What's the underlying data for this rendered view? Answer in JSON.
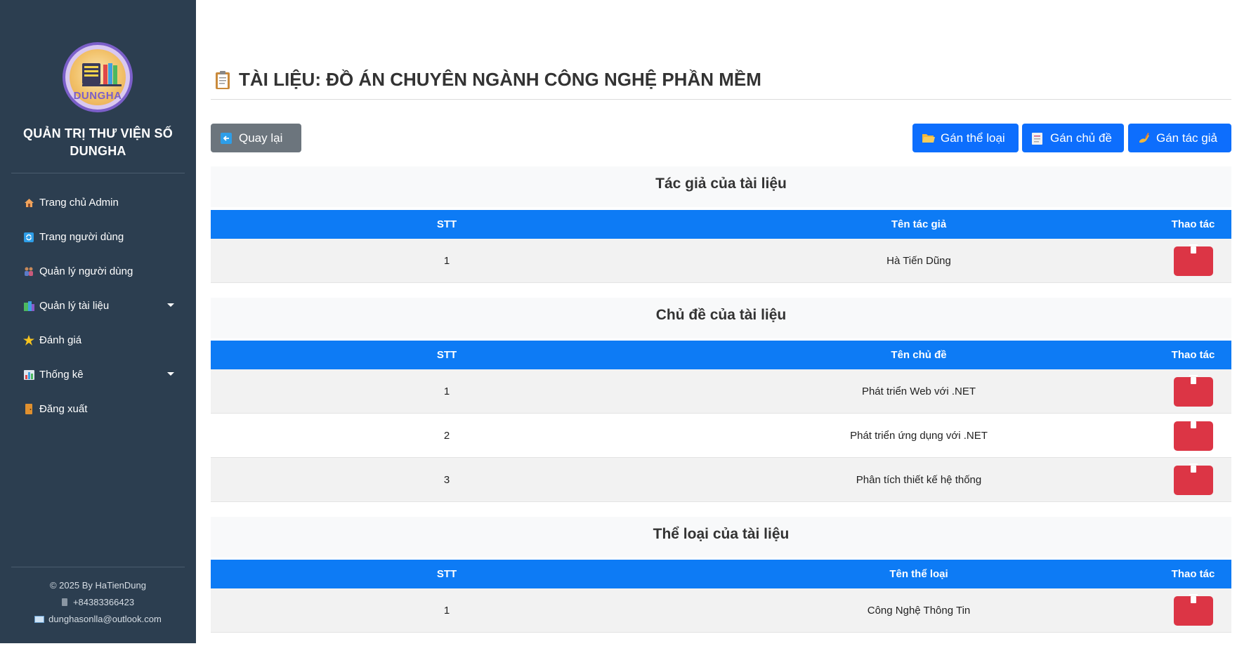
{
  "sidebar": {
    "logo_text": "DUNGHA",
    "brand_line1": "QUẢN TRỊ THƯ VIỆN SỐ",
    "brand_line2": "DUNGHA",
    "items": [
      {
        "label": "Trang chủ Admin",
        "icon": "home-icon"
      },
      {
        "label": "Trang người dùng",
        "icon": "refresh-icon"
      },
      {
        "label": "Quản lý người dùng",
        "icon": "users-icon"
      },
      {
        "label": "Quản lý tài liệu",
        "icon": "books-icon",
        "dropdown": true
      },
      {
        "label": "Đánh giá",
        "icon": "star-icon"
      },
      {
        "label": "Thống kê",
        "icon": "chart-icon",
        "dropdown": true
      },
      {
        "label": "Đăng xuất",
        "icon": "door-icon"
      }
    ],
    "footer": {
      "copyright": "© 2025 By HaTienDung",
      "phone": "+84383366423",
      "email": "dunghasonlla@outlook.com"
    }
  },
  "page": {
    "title": "TÀI LIỆU: ĐỒ ÁN CHUYÊN NGÀNH CÔNG NGHỆ PHẦN MỀM",
    "back_label": "Quay lại",
    "assign_genre_label": "Gán thể loại",
    "assign_topic_label": "Gán chủ đề",
    "assign_author_label": "Gán tác giả"
  },
  "authors": {
    "heading": "Tác giả của tài liệu",
    "columns": [
      "STT",
      "Tên tác giả",
      "Thao tác"
    ],
    "rows": [
      {
        "stt": "1",
        "name": "Hà Tiến Dũng"
      }
    ]
  },
  "topics": {
    "heading": "Chủ đề của tài liệu",
    "columns": [
      "STT",
      "Tên chủ đề",
      "Thao tác"
    ],
    "rows": [
      {
        "stt": "1",
        "name": "Phát triển Web với .NET"
      },
      {
        "stt": "2",
        "name": "Phát triển ứng dụng với .NET"
      },
      {
        "stt": "3",
        "name": "Phân tích thiết kế hệ thống"
      }
    ]
  },
  "genres": {
    "heading": "Thể loại của tài liệu",
    "columns": [
      "STT",
      "Tên thể loại",
      "Thao tác"
    ],
    "rows": [
      {
        "stt": "1",
        "name": "Công Nghệ Thông Tin"
      }
    ]
  },
  "colors": {
    "sidebar_bg": "#2c3e50",
    "primary": "#0d6efd",
    "table_header": "#0d7bf5",
    "danger": "#dc3545",
    "secondary": "#6c757d"
  }
}
